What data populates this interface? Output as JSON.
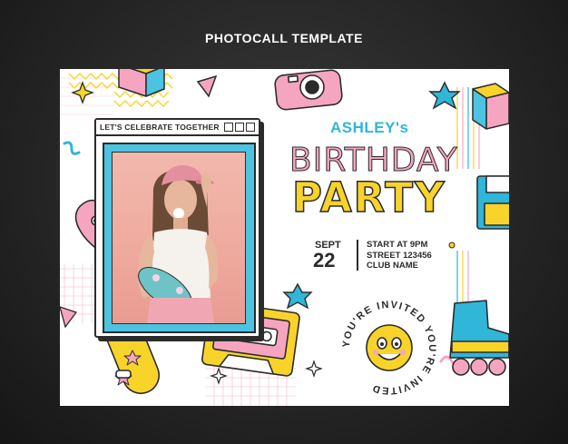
{
  "header": {
    "label": "PHOTOCALL TEMPLATE"
  },
  "poster": {
    "window_title": "LET'S CELEBRATE TOGETHER",
    "name": "ASHLEY's",
    "title_line1": "BIRTHDAY",
    "title_line2": "PARTY",
    "date": {
      "month": "SEPT",
      "day": "22"
    },
    "details": [
      "START AT 9PM",
      "STREET 123456",
      "CLUB NAME"
    ],
    "badge_text": "YOU'RE INVITED YOU'RE INVITED",
    "colors": {
      "pink": "#f6a5c0",
      "yellow": "#f8d32a",
      "blue": "#2fb6d9",
      "outline": "#2b2b2b"
    }
  }
}
